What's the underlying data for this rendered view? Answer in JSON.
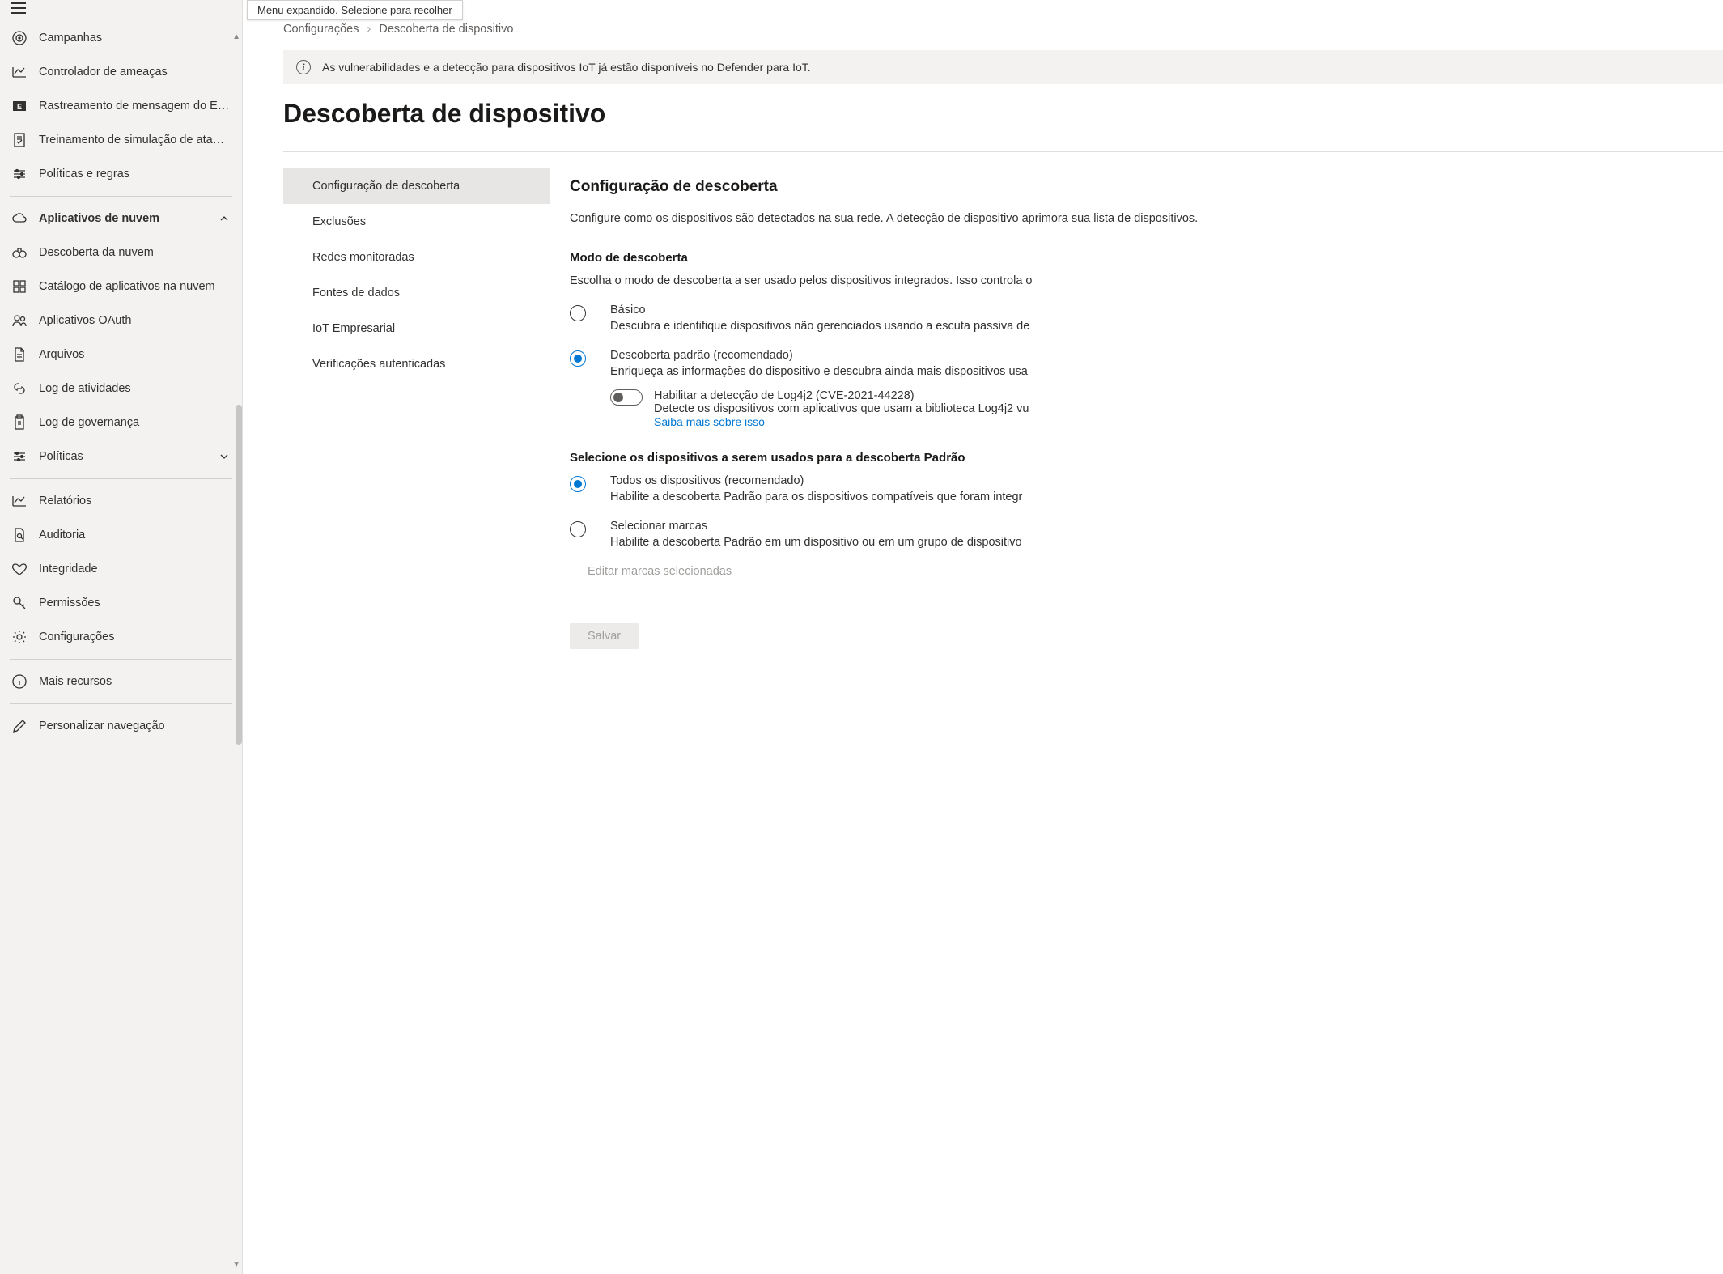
{
  "tooltip": "Menu expandido. Selecione para recolher",
  "sidebar": {
    "items": [
      {
        "label": "Campanhas"
      },
      {
        "label": "Controlador de ameaças"
      },
      {
        "label": "Rastreamento de mensagem do Ex..."
      },
      {
        "label": "Treinamento de simulação de ataque"
      },
      {
        "label": "Políticas e regras"
      },
      {
        "label": "Aplicativos de nuvem"
      },
      {
        "label": "Descoberta da nuvem"
      },
      {
        "label": "Catálogo de aplicativos na nuvem"
      },
      {
        "label": "Aplicativos OAuth"
      },
      {
        "label": "Arquivos"
      },
      {
        "label": "Log de atividades"
      },
      {
        "label": "Log de governança"
      },
      {
        "label": "Políticas"
      },
      {
        "label": "Relatórios"
      },
      {
        "label": "Auditoria"
      },
      {
        "label": "Integridade"
      },
      {
        "label": "Permissões"
      },
      {
        "label": "Configurações"
      },
      {
        "label": "Mais recursos"
      },
      {
        "label": "Personalizar navegação"
      }
    ]
  },
  "breadcrumb": {
    "item1": "Configurações",
    "item2": "Descoberta de dispositivo"
  },
  "banner": "As vulnerabilidades e a detecção para dispositivos IoT já estão disponíveis no Defender para IoT.",
  "page_title": "Descoberta de dispositivo",
  "subnav": {
    "items": [
      "Configuração de descoberta",
      "Exclusões",
      "Redes monitoradas",
      "Fontes de dados",
      "IoT Empresarial",
      "Verificações autenticadas"
    ]
  },
  "detail": {
    "title": "Configuração de descoberta",
    "desc": "Configure como os dispositivos são detectados na sua rede. A detecção de dispositivo aprimora sua lista de dispositivos.",
    "mode_heading": "Modo de descoberta",
    "mode_desc": "Escolha o modo de descoberta a ser usado pelos dispositivos integrados. Isso controla o",
    "basic_label": "Básico",
    "basic_desc": "Descubra e identifique dispositivos não gerenciados usando a escuta passiva de",
    "standard_label": "Descoberta padrão (recomendado)",
    "standard_desc": "Enriqueça as informações do dispositivo e descubra ainda mais dispositivos usa",
    "log4j_label": "Habilitar a detecção de Log4j2 (CVE-2021-44228)",
    "log4j_desc": "Detecte os dispositivos com aplicativos que usam a biblioteca Log4j2 vu",
    "log4j_link": "Saiba mais sobre isso",
    "select_heading": "Selecione os dispositivos a serem usados para a descoberta Padrão",
    "all_label": "Todos os dispositivos (recomendado)",
    "all_desc": "Habilite a descoberta Padrão para os dispositivos compatíveis que foram integr",
    "tags_label": "Selecionar marcas",
    "tags_desc": "Habilite a descoberta Padrão em um dispositivo ou em um grupo de dispositivo",
    "tags_placeholder": "Editar marcas selecionadas",
    "save": "Salvar"
  }
}
